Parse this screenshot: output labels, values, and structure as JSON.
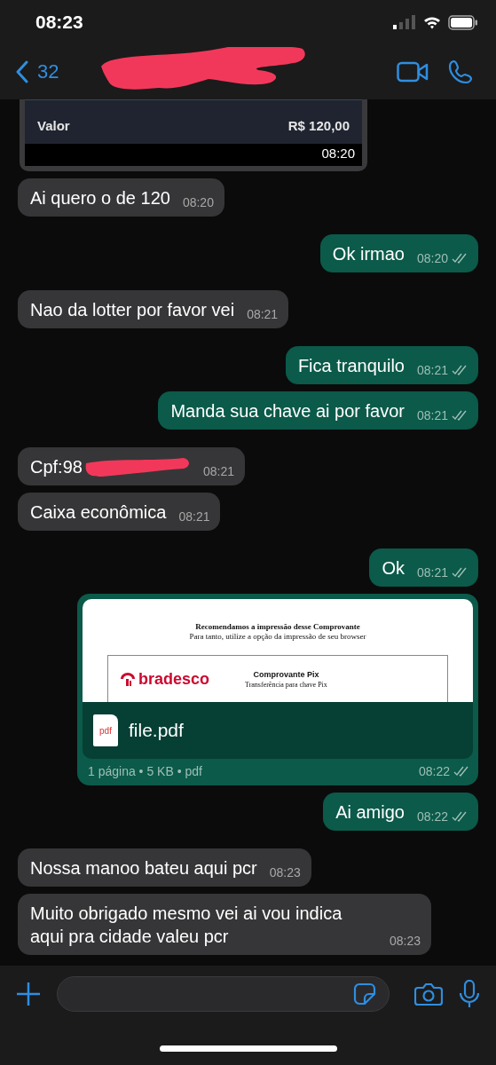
{
  "status_bar": {
    "time": "08:23"
  },
  "header": {
    "back_count": "32",
    "name_redacted": true
  },
  "messages": [
    {
      "kind": "card",
      "outgoing": false,
      "label": "Valor",
      "value": "R$ 120,00",
      "time": "08:20"
    },
    {
      "kind": "text",
      "outgoing": false,
      "text": "Ai quero o de 120",
      "time": "08:20"
    },
    {
      "kind": "text",
      "outgoing": true,
      "text": "Ok irmao",
      "time": "08:20",
      "delivered": true
    },
    {
      "kind": "text",
      "outgoing": false,
      "text": "Nao da lotter por favor vei",
      "time": "08:21"
    },
    {
      "kind": "text",
      "outgoing": true,
      "text": "Fica tranquilo",
      "time": "08:21",
      "delivered": true
    },
    {
      "kind": "text",
      "outgoing": true,
      "text": "Manda sua chave ai por favor",
      "time": "08:21",
      "delivered": true
    },
    {
      "kind": "text",
      "outgoing": false,
      "text": "Cpf:98",
      "redacted": true,
      "time": "08:21"
    },
    {
      "kind": "text",
      "outgoing": false,
      "text": "Caixa econômica",
      "time": "08:21"
    },
    {
      "kind": "text",
      "outgoing": true,
      "text": "Ok",
      "time": "08:21",
      "delivered": true
    },
    {
      "kind": "document",
      "outgoing": true,
      "preview": {
        "heading": "Recomendamos a impressão desse Comprovante",
        "subheading": "Para tanto, utilize a opção da impressão de seu browser",
        "bank": "bradesco",
        "title": "Comprovante Pix",
        "subtitle": "Transferência para chave Pix"
      },
      "file_type": "pdf",
      "file_name": "file.pdf",
      "meta": "1 página • 5 KB • pdf",
      "time": "08:22",
      "delivered": true
    },
    {
      "kind": "text",
      "outgoing": true,
      "text": "Ai amigo",
      "time": "08:22",
      "delivered": true
    },
    {
      "kind": "text",
      "outgoing": false,
      "text": "Nossa manoo bateu aqui pcr",
      "time": "08:23"
    },
    {
      "kind": "text",
      "outgoing": false,
      "text": "Muito obrigado mesmo vei ai vou indica aqui pra cidade valeu pcr",
      "time": "08:23"
    }
  ]
}
